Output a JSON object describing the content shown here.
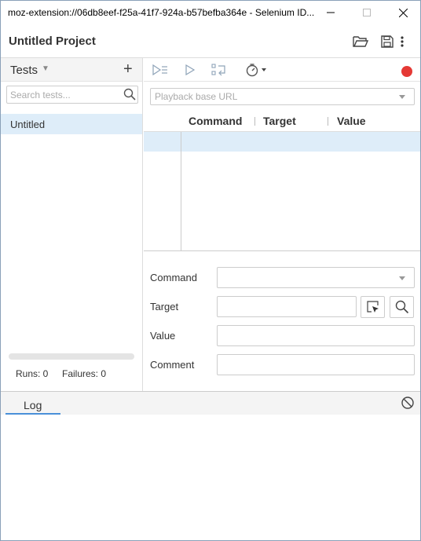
{
  "window": {
    "title": "moz-extension://06db8eef-f25a-41f7-924a-b57befba364e - Selenium ID...",
    "minimize_icon": "minimize-icon",
    "maximize_icon": "maximize-icon",
    "close_icon": "close-icon"
  },
  "header": {
    "project_name": "Untitled Project",
    "icons": [
      "open-project-icon",
      "save-project-icon",
      "more-vert-icon"
    ]
  },
  "sidebar": {
    "section_label": "Tests",
    "search_placeholder": "Search tests...",
    "tests": [
      {
        "name": "Untitled",
        "selected": true
      }
    ],
    "runs_text": "Runs: 0",
    "failures_text": "Failures: 0",
    "progress": 0
  },
  "toolbar": {
    "icons": [
      "run-all-tests-icon",
      "run-current-test-icon",
      "step-over-icon",
      "test-speed-icon",
      "record-icon"
    ],
    "record_color": "#e53935",
    "url_placeholder": "Playback base URL"
  },
  "table": {
    "columns": [
      "Command",
      "Target",
      "Value"
    ]
  },
  "editor": {
    "command_label": "Command",
    "target_label": "Target",
    "value_label": "Value",
    "comment_label": "Comment",
    "command_value": "",
    "target_value": "",
    "value_value": "",
    "comment_value": ""
  },
  "log": {
    "tab_label": "Log",
    "clear_icon": "clear-log-icon"
  },
  "colors": {
    "selected_row": "#deedf9",
    "accent": "#4a90d9",
    "record": "#e53935"
  }
}
